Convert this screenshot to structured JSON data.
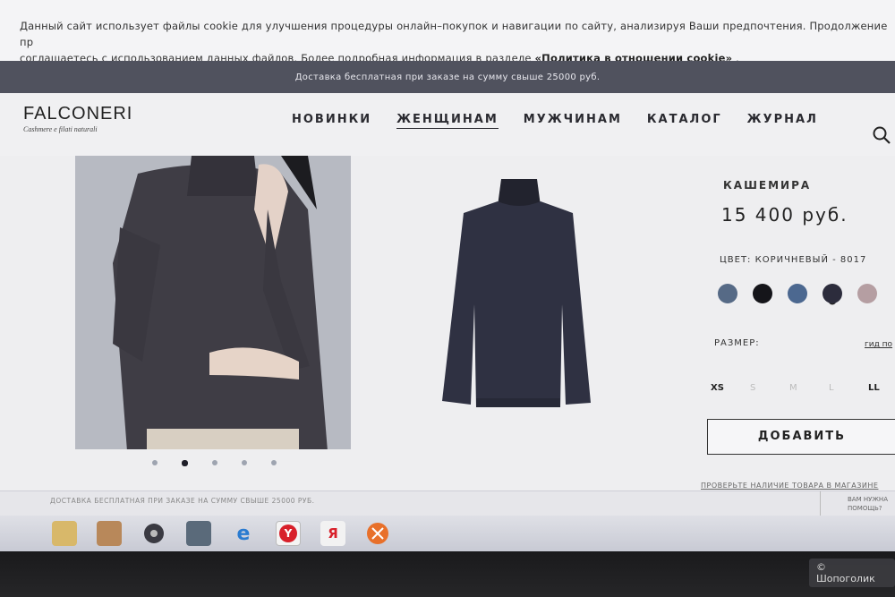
{
  "cookie_banner": {
    "text_line1": "Данный сайт использует файлы cookie для улучшения процедуры онлайн–покупок и навигации по сайту, анализируя Ваши предпочтения. Продолжение пр",
    "text_line2": "соглашаетесь с использованием данных файлов. Более подробная информация в разделе",
    "link": "«Политика в отношении cookie»"
  },
  "promo_bar": {
    "text": "Доставка бесплатная при заказе на сумму свыше 25000 руб."
  },
  "header": {
    "logo_name": "FALCONERI",
    "logo_tagline": "Cashmere e filati naturali",
    "nav": [
      {
        "label": "НОВИНКИ",
        "active": false
      },
      {
        "label": "ЖЕНЩИНАМ",
        "active": true
      },
      {
        "label": "МУЖЧИНАМ",
        "active": false
      },
      {
        "label": "КАТАЛОГ",
        "active": false
      },
      {
        "label": "ЖУРНАЛ",
        "active": false
      }
    ],
    "search_icon": "search-icon"
  },
  "gallery": {
    "dot_count": 5,
    "active_dot": 2
  },
  "product": {
    "name": "КАШЕМИРА",
    "price": "15 400 руб.",
    "color_label": "ЦВЕТ: КОРИЧНЕВЫЙ - 8017",
    "swatches": [
      "#566a86",
      "#15151a",
      "#4c6890",
      "#2c2c3c",
      "#b59ea2"
    ],
    "selected_swatch": 3,
    "size_label": "РАЗМЕР:",
    "size_guide": "гид по",
    "sizes": [
      {
        "label": "XS",
        "available": true
      },
      {
        "label": "S",
        "available": false
      },
      {
        "label": "M",
        "available": false
      },
      {
        "label": "L",
        "available": false
      },
      {
        "label": "LL",
        "available": true
      }
    ],
    "add_button": "ДОБАВИТЬ",
    "check_store": "ПРОВЕРЬТЕ НАЛИЧИЕ ТОВАРА В МАГАЗИНЕ"
  },
  "footer": {
    "text": "ДОСТАВКА БЕСПЛАТНАЯ ПРИ ЗАКАЗЕ НА СУММУ СВЫШЕ 25000 РУБ.",
    "help_line1": "ВАМ НУЖНА",
    "help_line2": "ПОМОЩЬ?"
  },
  "taskbar": {
    "icons": [
      "folder-icon",
      "media-player-icon",
      "disc-icon",
      "network-icon",
      "internet-explorer-icon",
      "yandex-browser-icon",
      "yandex-icon",
      "app-orange-icon"
    ],
    "yandex_browser_glyph": "Y",
    "yandex_glyph": "Я"
  },
  "watermark": {
    "text": "© Шопоголик"
  }
}
